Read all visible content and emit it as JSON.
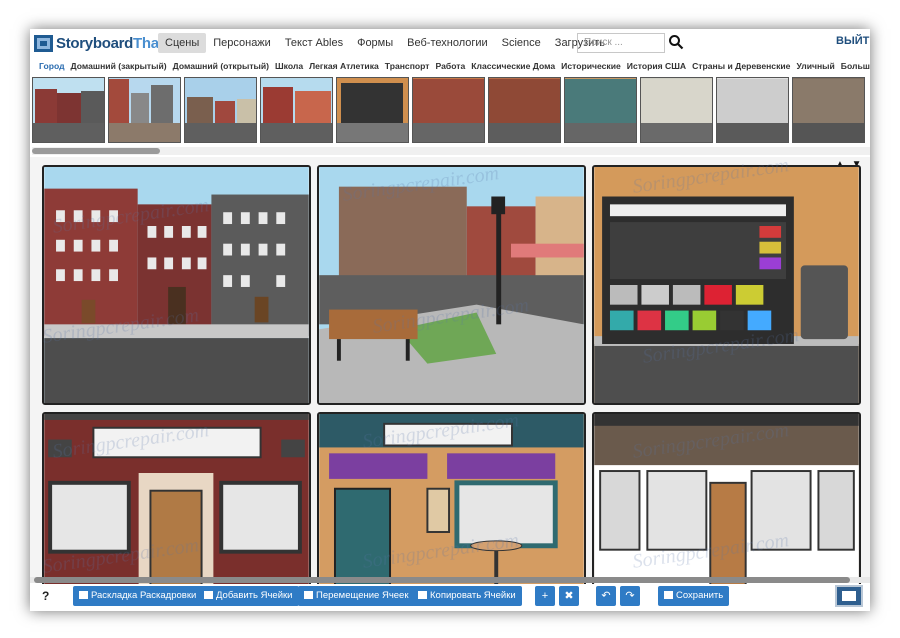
{
  "app": {
    "logo_part1": "Storyboard",
    "logo_part2": "That"
  },
  "nav": {
    "items": [
      "Сцены",
      "Персонажи",
      "Текст Ables",
      "Формы",
      "Веб-технологии",
      "Science",
      "Загрузить"
    ],
    "active_index": 0,
    "search_placeholder": "Поиск ...",
    "logout": "ВЫЙТИ"
  },
  "categories": {
    "items": [
      "Город",
      "Домашний (закрытый)",
      "Домашний (открытый)",
      "Школа",
      "Легкая Атлетика",
      "Транспорт",
      "Работа",
      "Классические Дома",
      "Исторические",
      "История США",
      "Страны и Деревенские",
      "Уличный"
    ],
    "more": "Больше",
    "active_index": 0
  },
  "scroll_arrows": "▲ ▼",
  "toolbar": {
    "help": "?",
    "layout": "Раскладка Раскадровки",
    "add_cells": "Добавить Ячейки",
    "move_cells": "Перемещение Ячеек",
    "copy_cells": "Копировать Ячейки",
    "plus": "+",
    "shrink": "✖",
    "undo": "↶",
    "redo": "↷",
    "save": "Сохранить"
  },
  "watermark": "Soringpcrepair.com",
  "colors": {
    "accent": "#2f7bc5",
    "brand": "#1f4e7d"
  }
}
